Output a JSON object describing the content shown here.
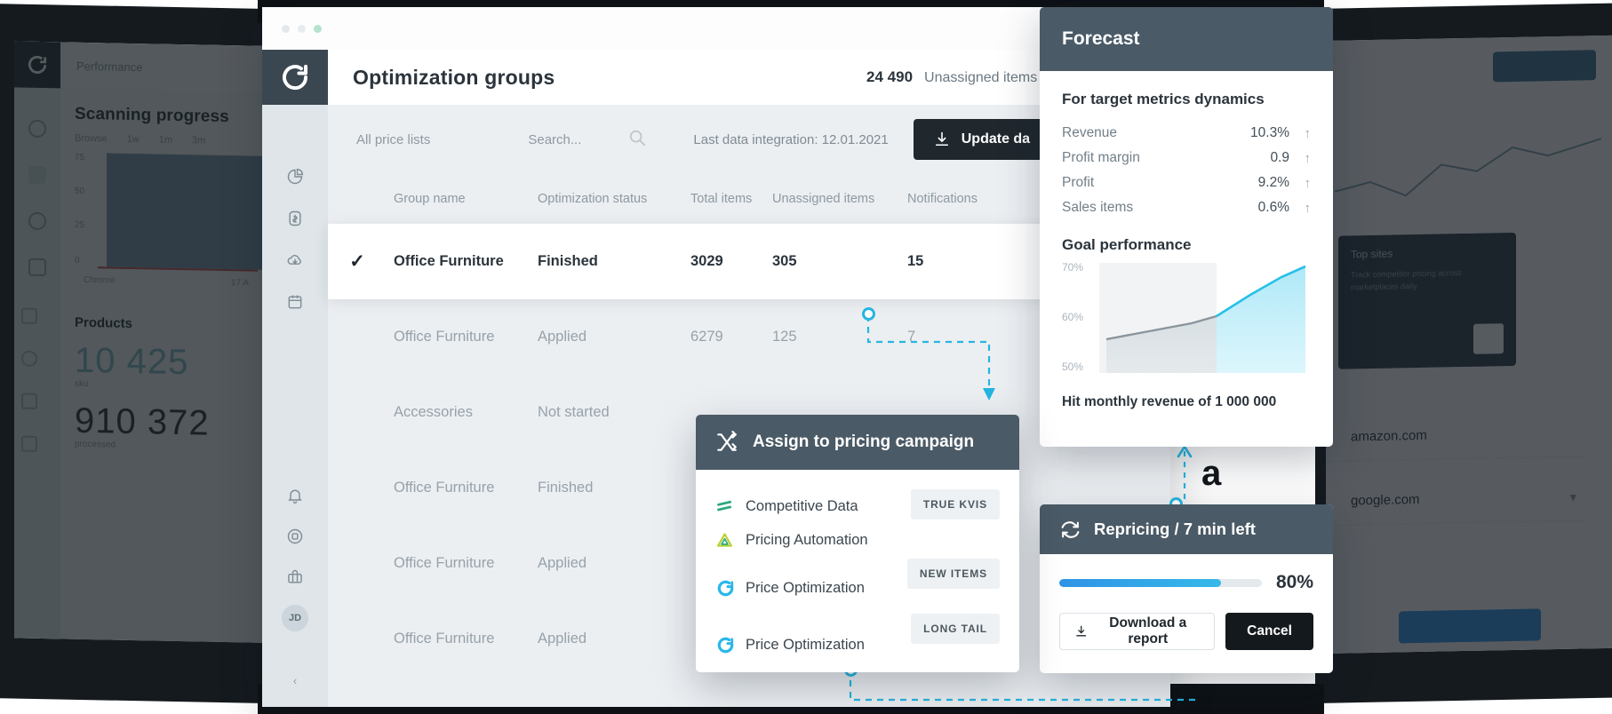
{
  "window": {
    "dots": [
      "close",
      "minimize",
      "maximize"
    ]
  },
  "sidebar": {
    "logo_icon": "circular-arrow-logo",
    "items": [
      {
        "icon": "pie-chart-icon",
        "name": "analytics"
      },
      {
        "icon": "price-tag-icon",
        "name": "pricing"
      },
      {
        "icon": "cloud-download-icon",
        "name": "data-import"
      },
      {
        "icon": "calendar-icon",
        "name": "calendar"
      }
    ],
    "bottom_items": [
      {
        "icon": "bell-icon",
        "name": "notifications"
      },
      {
        "icon": "settings-icon",
        "name": "settings"
      },
      {
        "icon": "briefcase-icon",
        "name": "workspace"
      }
    ],
    "avatar_initials": "JD",
    "collapse_glyph": "‹"
  },
  "header": {
    "title": "Optimization groups",
    "unassigned_count": "24 490",
    "unassigned_text": "Unassigned items won't be repriced"
  },
  "toolbar": {
    "price_lists": "All price lists",
    "search_placeholder": "Search...",
    "search_icon": "search-icon",
    "last_integration": "Last data integration: 12.01.2021",
    "update_button": "Update da",
    "update_icon": "download-icon"
  },
  "table": {
    "columns": [
      "Group name",
      "Optimization status",
      "Total items",
      "Unassigned items",
      "Notifications"
    ],
    "rows": [
      {
        "selected": true,
        "name": "Office Furniture",
        "status": "Finished",
        "total": "3029",
        "unassigned": "305",
        "notifications": "15"
      },
      {
        "selected": false,
        "name": "Office Furniture",
        "status": "Applied",
        "total": "6279",
        "unassigned": "125",
        "notifications": "7"
      },
      {
        "selected": false,
        "name": "Accessories",
        "status": "Not started",
        "total": "",
        "unassigned": "",
        "notifications": ""
      },
      {
        "selected": false,
        "name": "Office Furniture",
        "status": "Finished",
        "total": "",
        "unassigned": "",
        "notifications": ""
      },
      {
        "selected": false,
        "name": "Office Furniture",
        "status": "Applied",
        "total": "",
        "unassigned": "",
        "notifications": ""
      },
      {
        "selected": false,
        "name": "Office Furniture",
        "status": "Applied",
        "total": "",
        "unassigned": "",
        "notifications": ""
      }
    ]
  },
  "forecast": {
    "title": "Forecast",
    "section_title": "For target metrics dynamics",
    "metrics": [
      {
        "label": "Revenue",
        "value": "10.3%",
        "trend": "up"
      },
      {
        "label": "Profit margin",
        "value": "0.9",
        "trend": "up"
      },
      {
        "label": "Profit",
        "value": "9.2%",
        "trend": "up"
      },
      {
        "label": "Sales items",
        "value": "0.6%",
        "trend": "up"
      }
    ],
    "goal_title": "Goal performance",
    "note": "Hit monthly revenue of 1 000 000",
    "arrow_glyph": "↑"
  },
  "chart_data": {
    "type": "line",
    "title": "Goal performance",
    "x": [
      0,
      1,
      2,
      3,
      4,
      5,
      6,
      7,
      8
    ],
    "series": [
      {
        "name": "Goal performance",
        "values": [
          54,
          55,
          56,
          57,
          58,
          59,
          63,
          67,
          71
        ]
      }
    ],
    "ytick_labels": [
      "70%",
      "60%",
      "50%"
    ],
    "yticks": [
      70,
      60,
      50
    ],
    "ylim": [
      50,
      72
    ],
    "xlabel": "",
    "ylabel": "",
    "grid": false,
    "legend": "none",
    "forecast_split_x": 5,
    "accent_color": "#27c0e8",
    "past_color": "#8a949c",
    "annotation": "Hit monthly revenue of 1 000 000"
  },
  "repricing": {
    "title": "Repricing / 7 min left",
    "title_icon": "refresh-icon",
    "progress_pct": "80%",
    "progress_value": 80,
    "download_label": "Download a report",
    "download_icon": "download-icon",
    "cancel_label": "Cancel"
  },
  "assign": {
    "title": "Assign to pricing campaign",
    "title_icon": "shuffle-icon",
    "items": [
      {
        "label": "Competitive Data",
        "icon": "competitive-data-icon",
        "tag": "TRUE KVIS"
      },
      {
        "label": "Pricing Automation",
        "icon": "pricing-automation-icon",
        "tag": ""
      },
      {
        "label": "Price Optimization",
        "icon": "price-optimization-icon",
        "tag": "NEW ITEMS"
      },
      {
        "label": "Price Optimization",
        "icon": "price-optimization-icon",
        "tag": "LONG TAIL"
      }
    ]
  },
  "bg_left": {
    "topbar_text": "Performance",
    "chart_title": "Scanning progress",
    "tabs": [
      "Browse",
      "1w",
      "1m",
      "3m"
    ],
    "ylabels": [
      "75",
      "50",
      "25",
      "0"
    ],
    "xlabels": [
      "Chrome",
      "17 A"
    ],
    "section_title": "Products",
    "metric_teal": "10 425",
    "metric_teal_sub": "sku",
    "metric_dark": "910 372",
    "metric_dark_sub": "processed"
  },
  "bg_right": {
    "rows": [
      "amazon.com",
      "google.com"
    ],
    "card_title": "Top sites",
    "card_lines": "Track competitor\npricing across\nmarketplaces daily"
  },
  "colors": {
    "accent_cyan": "#25b6e0",
    "accent_blue": "#2f93e6",
    "card_header": "#4a5a66",
    "dark": "#20282e",
    "amazon_logo": "a"
  }
}
